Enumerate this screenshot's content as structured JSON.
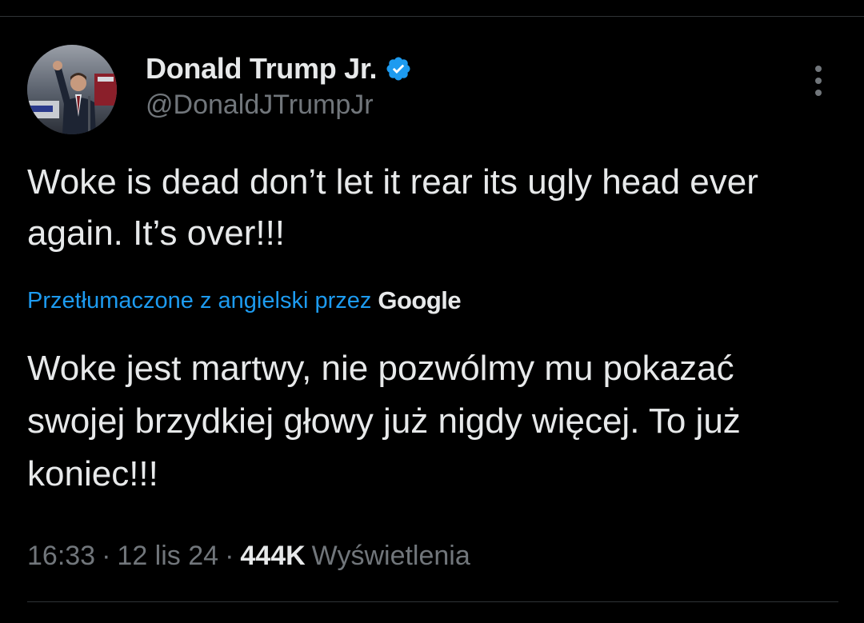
{
  "tweet": {
    "author": {
      "display_name": "Donald Trump Jr.",
      "handle": "@DonaldJTrumpJr",
      "verified": true,
      "avatar_icon": "profile-photo"
    },
    "text": "Woke is dead don’t let it rear its ugly head ever again. It’s over!!!",
    "translation": {
      "label": "Przetłumaczone z angielski przez",
      "provider": "Google",
      "text": "Woke jest martwy, nie pozwólmy mu pokazać swojej brzydkiej głowy już nigdy więcej. To już koniec!!!"
    },
    "meta": {
      "time": "16:33",
      "separator": "·",
      "date": "12 lis 24",
      "views_count": "444K",
      "views_label": "Wyświetlenia"
    }
  },
  "colors": {
    "background": "#000000",
    "text_primary": "#e7e9ea",
    "text_secondary": "#71767b",
    "accent": "#1d9bf0",
    "divider": "#2f3336"
  },
  "icons": {
    "verified": "verified-badge-icon",
    "more": "more-options-icon"
  }
}
